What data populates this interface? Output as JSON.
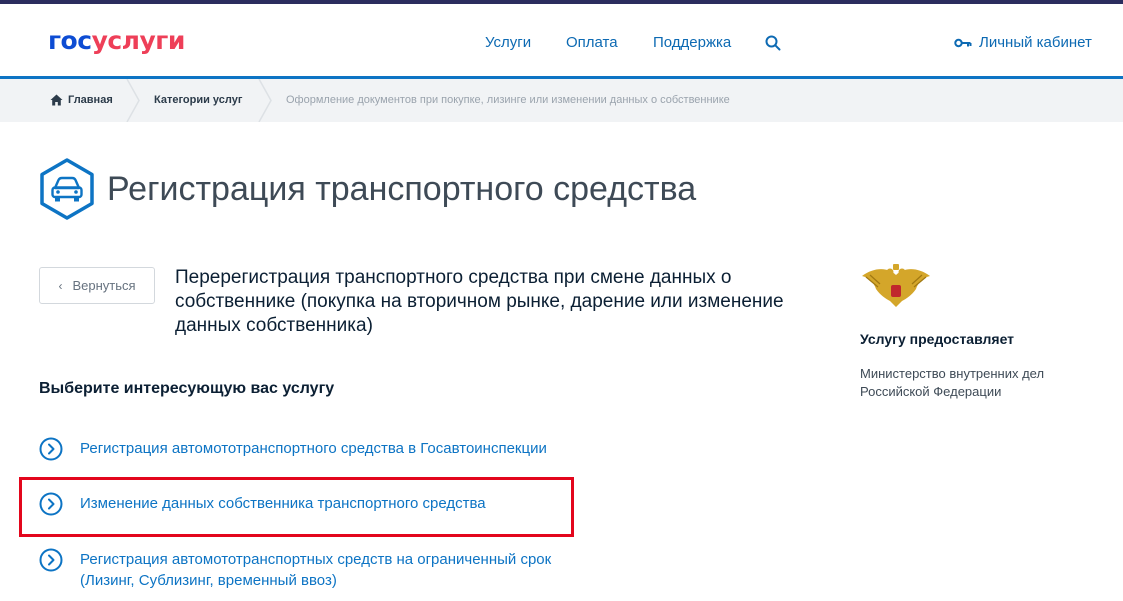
{
  "header": {
    "logo_part1": "гос",
    "logo_part2": "услуги",
    "nav": [
      "Услуги",
      "Оплата",
      "Поддержка"
    ],
    "account_label": "Личный кабинет"
  },
  "breadcrumbs": {
    "home": "Главная",
    "categories": "Категории услуг",
    "current": "Оформление документов при покупке, лизинге или изменении данных о собственнике"
  },
  "page": {
    "title": "Регистрация транспортного средства",
    "back_label": "Вернуться",
    "subtitle": "Перерегистрация транспортного средства при смене данных о собственнике (покупка на вторичном рынке, дарение или изменение данных собственника)",
    "choose_label": "Выберите интересующую вас услугу",
    "services": [
      {
        "line1": "Регистрация автомототранспортного средства в Госавтоинспекции",
        "line2": ""
      },
      {
        "line1": "Изменение данных собственника транспортного средства",
        "line2": ""
      },
      {
        "line1": "Регистрация автомототранспортных средств на ограниченный срок",
        "line2": "(Лизинг, Сублизинг, временный ввоз)"
      }
    ]
  },
  "provider": {
    "label": "Услугу предоставляет",
    "name": "Министерство внутренних дел Российской Федерации"
  },
  "colors": {
    "brand_blue": "#0d4cd3",
    "brand_red": "#ee3f58",
    "link_blue": "#0d74c4",
    "highlight_red": "#e3061c"
  },
  "icons": [
    "search-icon",
    "key-icon",
    "home-icon",
    "car-icon",
    "chevron-left-icon",
    "chevron-right-circle-icon",
    "coat-of-arms-emblem"
  ]
}
